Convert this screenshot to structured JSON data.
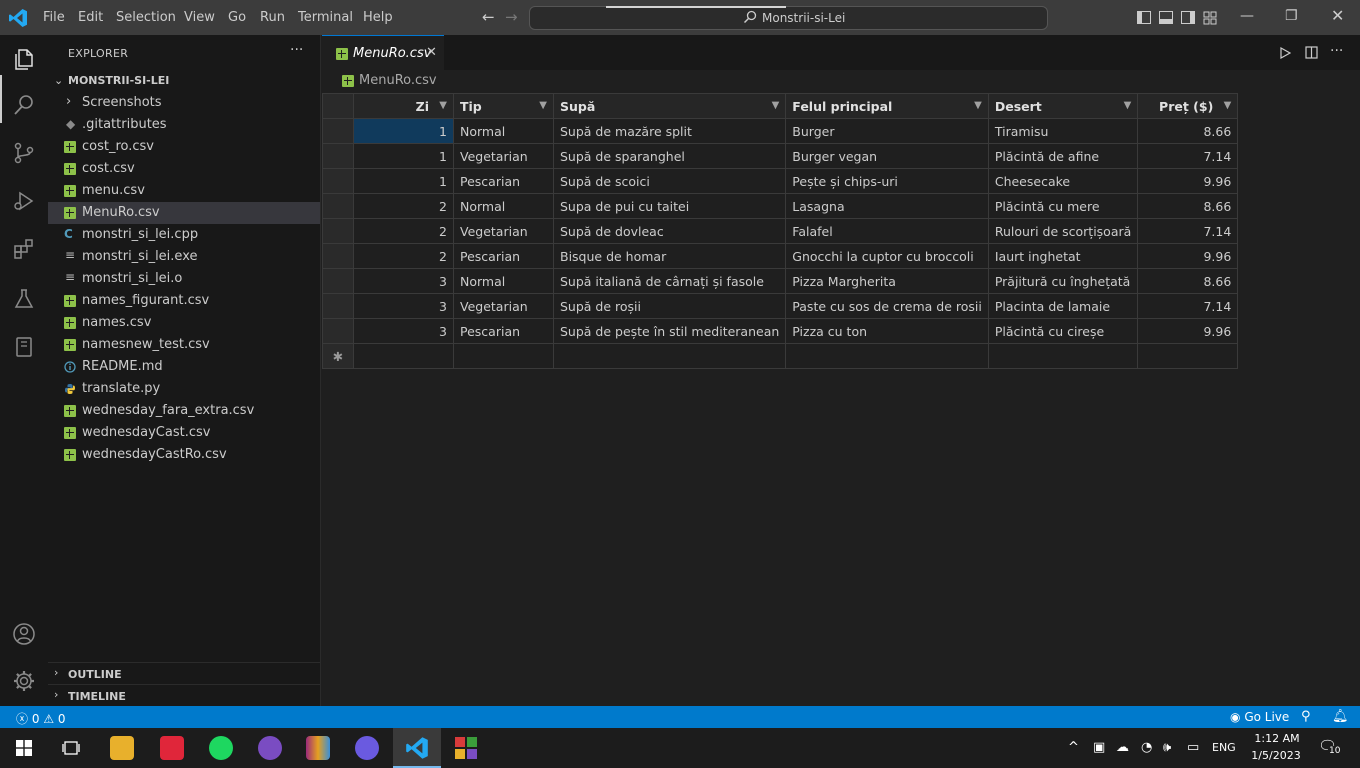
{
  "titlebar": {
    "menu": [
      "File",
      "Edit",
      "Selection",
      "View",
      "Go",
      "Run",
      "Terminal",
      "Help"
    ],
    "search_text": "Monstrii-si-Lei"
  },
  "sidebar": {
    "title": "EXPLORER",
    "root_folder": "MONSTRII-SI-LEI",
    "items": [
      {
        "label": "Screenshots",
        "icon": "chevron-right-icon"
      },
      {
        "label": ".gitattributes",
        "icon": "gitattributes-icon"
      },
      {
        "label": "cost_ro.csv",
        "icon": "csv-icon"
      },
      {
        "label": "cost.csv",
        "icon": "csv-icon"
      },
      {
        "label": "menu.csv",
        "icon": "csv-icon"
      },
      {
        "label": "MenuRo.csv",
        "icon": "csv-icon"
      },
      {
        "label": "monstri_si_lei.cpp",
        "icon": "cpp-icon"
      },
      {
        "label": "monstri_si_lei.exe",
        "icon": "file-lines-icon"
      },
      {
        "label": "monstri_si_lei.o",
        "icon": "file-lines-icon"
      },
      {
        "label": "names_figurant.csv",
        "icon": "csv-icon"
      },
      {
        "label": "names.csv",
        "icon": "csv-icon"
      },
      {
        "label": "namesnew_test.csv",
        "icon": "csv-icon"
      },
      {
        "label": "README.md",
        "icon": "info-icon"
      },
      {
        "label": "translate.py",
        "icon": "python-icon"
      },
      {
        "label": "wednesday_fara_extra.csv",
        "icon": "csv-icon"
      },
      {
        "label": "wednesdayCast.csv",
        "icon": "csv-icon"
      },
      {
        "label": "wednesdayCastRo.csv",
        "icon": "csv-icon"
      }
    ],
    "outline_label": "OUTLINE",
    "timeline_label": "TIMELINE"
  },
  "editor": {
    "tab_label": "MenuRo.csv",
    "breadcrumb": "MenuRo.csv",
    "grid": {
      "headers": [
        "Zi",
        "Tip",
        "Supă",
        "Felul principal",
        "Desert",
        "Preț ($)"
      ],
      "rows": [
        [
          "1",
          "Normal",
          "Supă de mazăre split",
          "Burger",
          "Tiramisu",
          "8.66"
        ],
        [
          "1",
          "Vegetarian",
          "Supă de sparanghel",
          "Burger vegan",
          "Plăcintă de afine",
          "7.14"
        ],
        [
          "1",
          "Pescarian",
          "Supă de scoici",
          "Pește și chips-uri",
          "Cheesecake",
          "9.96"
        ],
        [
          "2",
          "Normal",
          "Supa de pui cu taitei",
          "Lasagna",
          "Plăcintă cu mere",
          "8.66"
        ],
        [
          "2",
          "Vegetarian",
          "Supă de dovleac",
          "Falafel",
          "Rulouri de scorțișoară",
          "7.14"
        ],
        [
          "2",
          "Pescarian",
          "Bisque de homar",
          "Gnocchi la cuptor cu broccoli",
          "Iaurt inghetat",
          "9.96"
        ],
        [
          "3",
          "Normal",
          "Supă italiană de cârnați și fasole",
          "Pizza Margherita",
          "Prăjitură cu înghețată",
          "8.66"
        ],
        [
          "3",
          "Vegetarian",
          "Supă de roșii",
          "Paste cu sos de crema de rosii",
          "Placinta de lamaie",
          "7.14"
        ],
        [
          "3",
          "Pescarian",
          "Supă de pește în stil mediteranean",
          "Pizza cu ton",
          "Plăcintă cu cireșe",
          "9.96"
        ]
      ],
      "new_row_marker": "✱"
    }
  },
  "statusbar": {
    "errors": "0",
    "warnings": "0",
    "golive": "Go Live"
  },
  "taskbar": {
    "lang": "ENG",
    "time": "1:12 AM",
    "date": "1/5/2023",
    "notifications": "10"
  },
  "colors": {
    "accent": "#0078d4",
    "statusbar": "#007acc",
    "csv_icon": "#8dc149",
    "active_cell": "#103a5c"
  }
}
